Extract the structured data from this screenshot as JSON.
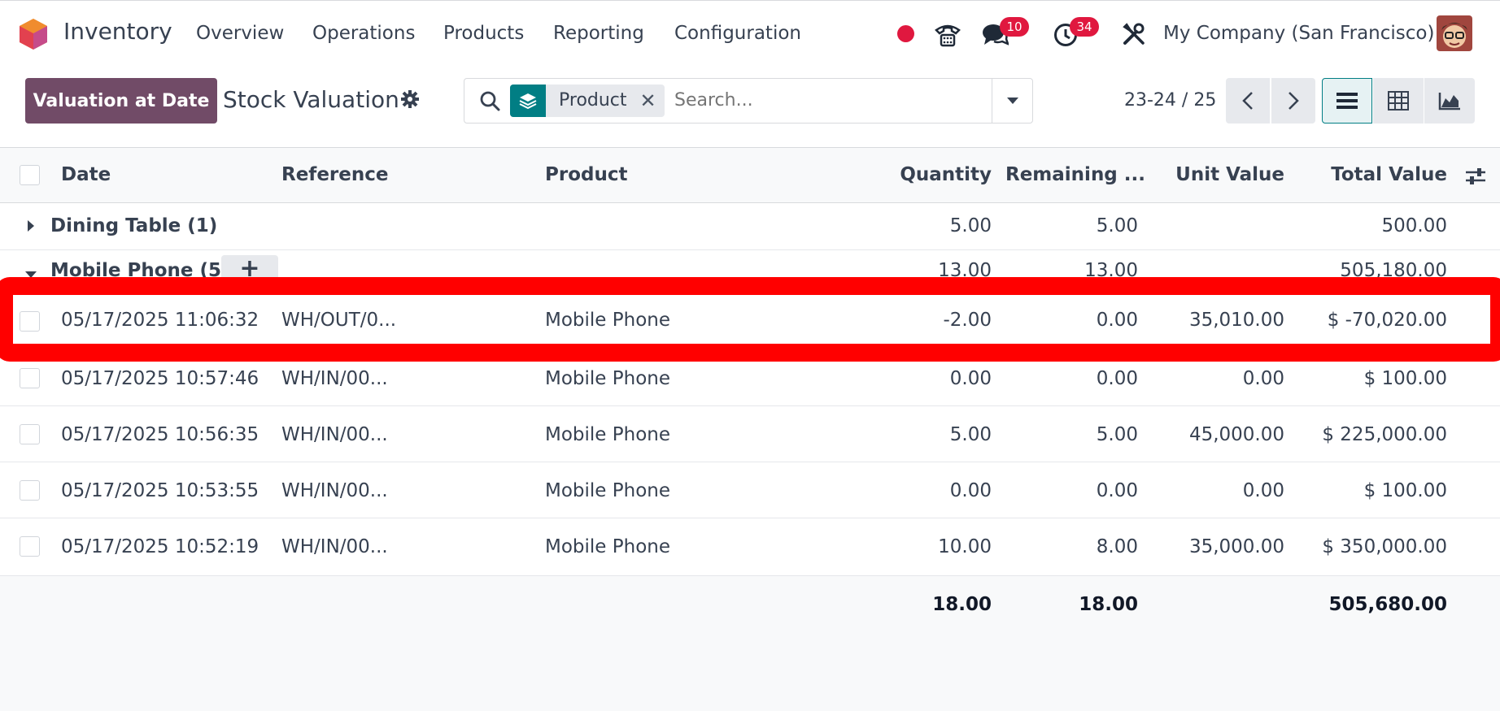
{
  "navbar": {
    "app_name": "Inventory",
    "menu": [
      "Overview",
      "Operations",
      "Products",
      "Reporting",
      "Configuration"
    ],
    "messages_badge": "10",
    "activities_badge": "34",
    "company": "My Company (San Francisco)",
    "icons": [
      "app-logo-icon",
      "status-dot-icon",
      "phone-icon",
      "chat-icon",
      "clock-icon",
      "tools-icon",
      "avatar"
    ]
  },
  "control_panel": {
    "primary_button": "Valuation at Date",
    "title": "Stock Valuation",
    "search": {
      "facet_label": "Product",
      "placeholder": "Search..."
    },
    "pager": "23-24 / 25"
  },
  "table": {
    "columns": [
      "Date",
      "Reference",
      "Product",
      "Quantity",
      "Remaining ...",
      "Unit Value",
      "Total Value"
    ],
    "groups": [
      {
        "label": "Dining Table (1)",
        "quantity": "5.00",
        "remaining": "5.00",
        "total": "500.00",
        "expanded": false
      },
      {
        "label": "Mobile Phone (5)",
        "quantity": "13.00",
        "remaining": "13.00",
        "total": "505,180.00",
        "expanded": true
      }
    ],
    "rows": [
      {
        "date": "05/17/2025 11:06:32",
        "reference": "WH/OUT/0...",
        "product": "Mobile Phone",
        "quantity": "-2.00",
        "remaining": "0.00",
        "unit_value": "35,010.00",
        "total_value": "$ -70,020.00"
      },
      {
        "date": "05/17/2025 10:57:46",
        "reference": "WH/IN/00...",
        "product": "Mobile Phone",
        "quantity": "0.00",
        "remaining": "0.00",
        "unit_value": "0.00",
        "total_value": "$ 100.00"
      },
      {
        "date": "05/17/2025 10:56:35",
        "reference": "WH/IN/00...",
        "product": "Mobile Phone",
        "quantity": "5.00",
        "remaining": "5.00",
        "unit_value": "45,000.00",
        "total_value": "$ 225,000.00"
      },
      {
        "date": "05/17/2025 10:53:55",
        "reference": "WH/IN/00...",
        "product": "Mobile Phone",
        "quantity": "0.00",
        "remaining": "0.00",
        "unit_value": "0.00",
        "total_value": "$ 100.00"
      },
      {
        "date": "05/17/2025 10:52:19",
        "reference": "WH/IN/00...",
        "product": "Mobile Phone",
        "quantity": "10.00",
        "remaining": "8.00",
        "unit_value": "35,000.00",
        "total_value": "$ 350,000.00"
      }
    ],
    "totals": {
      "quantity": "18.00",
      "remaining": "18.00",
      "total_value": "505,680.00"
    }
  },
  "colors": {
    "brand": "#714b67",
    "teal": "#017e84",
    "badge": "#e0183f",
    "highlight": "#ff0000"
  }
}
